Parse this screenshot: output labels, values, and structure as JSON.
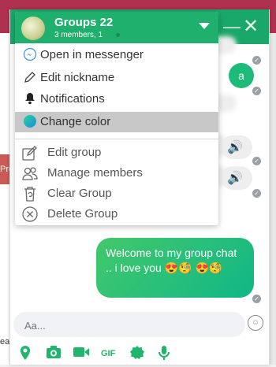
{
  "background": {
    "left_red_text": "Pro",
    "left_bottom_text": "ea"
  },
  "chat": {
    "my_bubble_letter": "a",
    "message_text": "Welcome to my group chat .. i love you 😍🧐 😍🧐",
    "composer_placeholder": "Aa...",
    "toolbar": {
      "gif_label": "GIF"
    }
  },
  "dropdown": {
    "group_title": "Groups 22",
    "group_subtitle": "3 members, 1",
    "items_top": [
      {
        "label": "Open in messenger",
        "icon": "messenger-icon"
      },
      {
        "label": "Edit nickname",
        "icon": "pencil-icon"
      },
      {
        "label": "Notifications",
        "icon": "bell-icon"
      },
      {
        "label": "Change color",
        "icon": "color-dot-icon",
        "selected": true
      }
    ],
    "items_bottom": [
      {
        "label": "Edit group",
        "icon": "edit-icon"
      },
      {
        "label": "Manage members",
        "icon": "members-icon"
      },
      {
        "label": "Clear Group",
        "icon": "trash-icon"
      },
      {
        "label": "Delete Group",
        "icon": "close-circle-icon"
      }
    ]
  },
  "colors": {
    "header_green": "#1aa86a",
    "bubble_gradient_start": "#43c86b",
    "bubble_gradient_end": "#10b787",
    "accent": "#1fb56a"
  }
}
